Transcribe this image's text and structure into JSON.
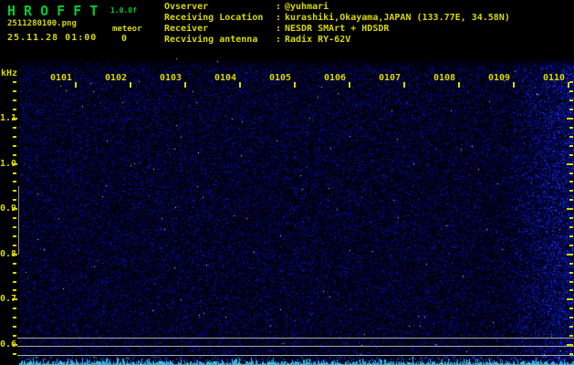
{
  "window": {
    "title": "H R O F F T",
    "version": "1.0.0f",
    "filename": "2511280100.png",
    "timestamp": "25.11.28 01:00",
    "meteor_label": "meteor",
    "meteor_count": "0"
  },
  "observer_info": {
    "separator": ":",
    "rows": [
      {
        "label": "Ovserver",
        "value": "@yuhmari"
      },
      {
        "label": "Receiving Location",
        "value": "kurashiki,Okayama,JAPAN (133.77E, 34.58N)"
      },
      {
        "label": "Receiver",
        "value": "NESDR SMArt + HDSDR"
      },
      {
        "label": "Recviving antenna",
        "value": "Radix RY-62V"
      }
    ]
  },
  "chart_data": {
    "type": "heatmap",
    "title": "HROFFT radio meteor echo spectrogram 0100-0110",
    "x_axis": {
      "unit": "time (HHMM)",
      "tick_labels": [
        "0101",
        "0102",
        "0103",
        "0104",
        "0105",
        "0106",
        "0107",
        "0108",
        "0109",
        "0110"
      ]
    },
    "y_axis": {
      "label": "kHz",
      "unit": "kHz",
      "major_ticks": [
        "1.1",
        "1.0",
        "0.9",
        "0.8",
        "0.7",
        "0.6"
      ],
      "minor_step_khz": 0.02,
      "top_khz": 1.18,
      "bottom_khz": 0.58
    },
    "overlay_lines": {
      "horizontal_y_khz": [
        0.616,
        0.598,
        0.578
      ],
      "vertical_marker_khz_range": [
        0.95,
        0.8
      ]
    },
    "meteor_echo_count": 0,
    "noise_description": "uniform dark-blue background noise; brighter noise band at right edge (~0109:30-0110); bright cyan signal-level strip along bottom edge"
  },
  "colors": {
    "background": "#000000",
    "title_green": "#00cc33",
    "text_yellow": "#d8d800",
    "grid_gray": "#a8a8a8",
    "marker_gray": "#909090",
    "noise_blue": "#0000aa",
    "strip_cyan": "#55ddee"
  }
}
